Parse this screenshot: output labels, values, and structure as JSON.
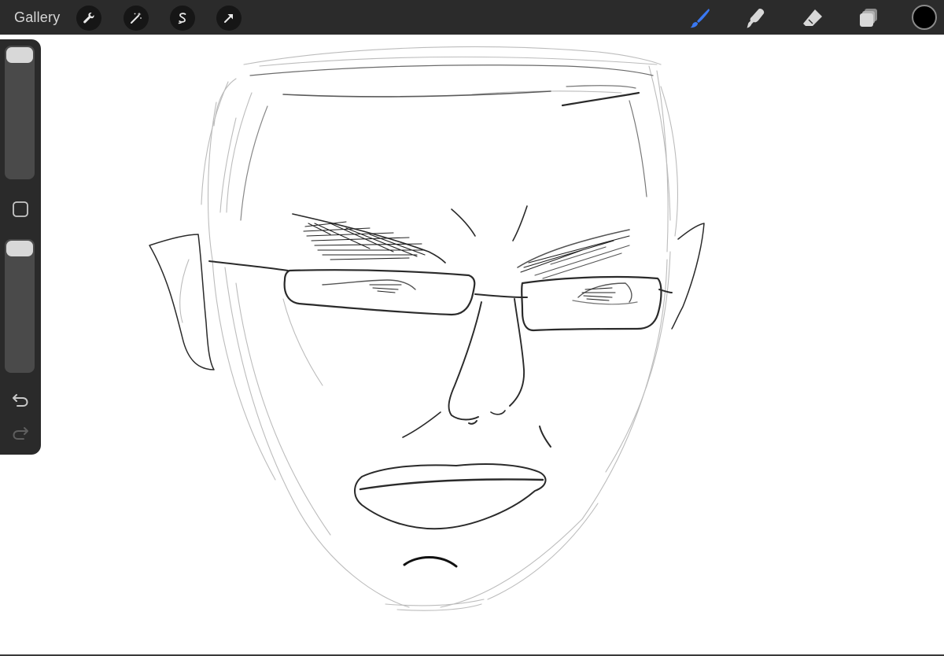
{
  "toolbar": {
    "gallery_label": "Gallery",
    "left_tools": [
      "wrench-icon",
      "magic-wand-icon",
      "selection-s-icon",
      "transform-arrow-icon"
    ],
    "right_tools": [
      "brush-icon",
      "smudge-icon",
      "eraser-icon",
      "layers-icon"
    ],
    "active_tool": "brush-icon",
    "active_tool_color": "#3a78f2",
    "current_color": "#000000"
  },
  "sidebar": {
    "brush_size_level": 1.0,
    "opacity_level": 1.0,
    "undo_icon": "undo-icon",
    "redo_icon": "redo-icon",
    "redo_enabled": false
  },
  "canvas": {
    "background": "#ffffff",
    "content": "pencil-sketch-face-with-glasses"
  }
}
